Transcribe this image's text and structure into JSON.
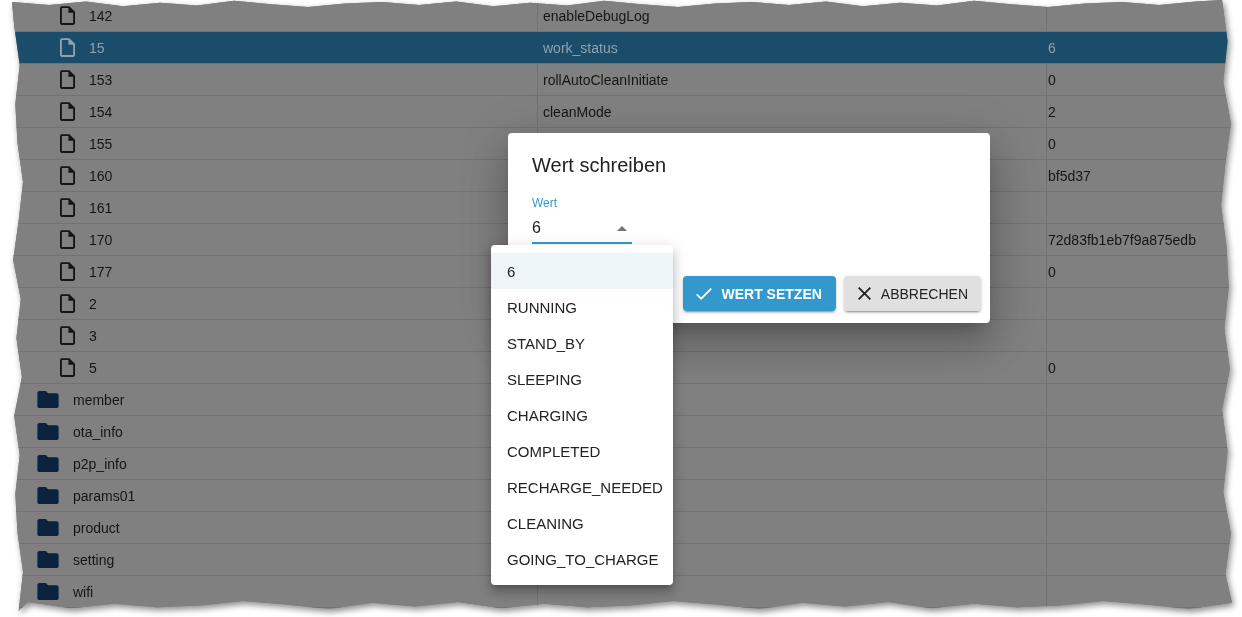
{
  "tree": [
    {
      "children": [
        {
          "kind": "state",
          "label": "142",
          "column_2": "enableDebugLog",
          "selected": false
        },
        {
          "kind": "state",
          "label": "15",
          "column_2": "work_status",
          "column_3": "6",
          "selected": true
        },
        {
          "kind": "state",
          "label": "153",
          "column_2": "rollAutoCleanInitiate",
          "column_3": "0",
          "selected": false
        },
        {
          "kind": "state",
          "label": "154",
          "column_2": "cleanMode",
          "column_3": "2",
          "selected": false
        },
        {
          "kind": "state",
          "label": "155",
          "column_3": "0",
          "selected": false
        },
        {
          "kind": "state",
          "label": "160",
          "column_3": "bf5d37",
          "selected": false
        },
        {
          "kind": "state",
          "label": "161",
          "selected": false
        },
        {
          "kind": "state",
          "label": "170",
          "column_3": "72d83fb1eb7f9a875edb",
          "selected": false
        },
        {
          "kind": "state",
          "label": "177",
          "column_3": "0",
          "selected": false
        },
        {
          "kind": "state",
          "label": "2",
          "selected": false
        },
        {
          "kind": "state",
          "label": "3",
          "selected": false
        },
        {
          "kind": "state",
          "label": "5",
          "column_3": "0",
          "selected": false
        }
      ]
    },
    {
      "kind": "folder",
      "label": "member",
      "selected": false
    },
    {
      "kind": "folder",
      "label": "ota_info",
      "selected": false
    },
    {
      "kind": "folder",
      "label": "p2p_info",
      "selected": false
    },
    {
      "kind": "folder",
      "label": "params01",
      "selected": false
    },
    {
      "kind": "folder",
      "label": "product",
      "selected": false
    },
    {
      "kind": "folder",
      "label": "setting",
      "selected": false
    },
    {
      "kind": "folder",
      "label": "wifi",
      "selected": false
    }
  ],
  "dialog": {
    "title": "Wert schreiben",
    "field": {
      "label": "Wert",
      "value": "6",
      "open": true,
      "options": [
        {
          "label": "6",
          "selected": true
        },
        {
          "label": "RUNNING",
          "selected": false
        },
        {
          "label": "STAND_BY",
          "selected": false
        },
        {
          "label": "SLEEPING",
          "selected": false
        },
        {
          "label": "CHARGING",
          "selected": false
        },
        {
          "label": "COMPLETED",
          "selected": false
        },
        {
          "label": "RECHARGE_NEEDED",
          "selected": false
        },
        {
          "label": "CLEANING",
          "selected": false
        },
        {
          "label": "GOING_TO_CHARGE",
          "selected": false
        }
      ]
    },
    "buttons": [
      {
        "kind": "confirm",
        "label": "WERT SETZEN"
      },
      {
        "kind": "cancel",
        "label": "ABBRECHEN"
      }
    ]
  }
}
